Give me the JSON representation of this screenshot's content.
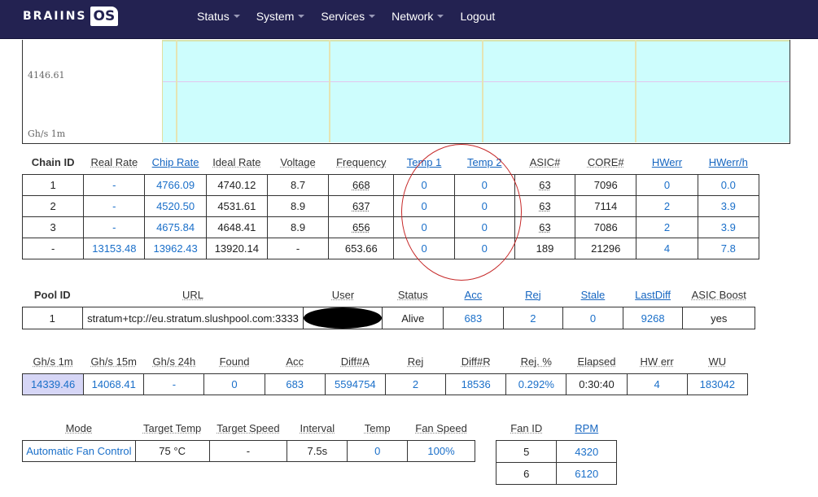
{
  "brand": {
    "name": "BRAIINS",
    "badge": "OS"
  },
  "nav": [
    "Status",
    "System",
    "Services",
    "Network",
    "Logout"
  ],
  "graph": {
    "ymax_label": "4146.61",
    "unit_label": "Gh/s 1m"
  },
  "chains": {
    "headers": [
      "Chain ID",
      "Real Rate",
      "Chip Rate",
      "Ideal Rate",
      "Voltage",
      "Frequency",
      "Temp 1",
      "Temp 2",
      "ASIC#",
      "CORE#",
      "HWerr",
      "HWerr/h"
    ],
    "rows": [
      [
        "1",
        "-",
        "4766.09",
        "4740.12",
        "8.7",
        "668",
        "0",
        "0",
        "63",
        "7096",
        "0",
        "0.0"
      ],
      [
        "2",
        "-",
        "4520.50",
        "4531.61",
        "8.9",
        "637",
        "0",
        "0",
        "63",
        "7114",
        "2",
        "3.9"
      ],
      [
        "3",
        "-",
        "4675.84",
        "4648.41",
        "8.9",
        "656",
        "0",
        "0",
        "63",
        "7086",
        "2",
        "3.9"
      ],
      [
        "-",
        "13153.48",
        "13962.43",
        "13920.14",
        "-",
        "653.66",
        "0",
        "0",
        "189",
        "21296",
        "4",
        "7.8"
      ]
    ]
  },
  "pools": {
    "headers": [
      "Pool ID",
      "URL",
      "User",
      "Status",
      "Acc",
      "Rej",
      "Stale",
      "LastDiff",
      "ASIC Boost"
    ],
    "row": [
      "1",
      "stratum+tcp://eu.stratum.slushpool.com:3333",
      "",
      "Alive",
      "683",
      "2",
      "0",
      "9268",
      "yes"
    ]
  },
  "summary": {
    "headers": [
      "Gh/s 1m",
      "Gh/s 15m",
      "Gh/s 24h",
      "Found",
      "Acc",
      "Diff#A",
      "Rej",
      "Diff#R",
      "Rej. %",
      "Elapsed",
      "HW err",
      "WU"
    ],
    "row": [
      "14339.46",
      "14068.41",
      "-",
      "0",
      "683",
      "5594754",
      "2",
      "18536",
      "0.292%",
      "0:30:40",
      "4",
      "183042"
    ]
  },
  "fan": {
    "headers": [
      "Mode",
      "Target Temp",
      "Target Speed",
      "Interval",
      "Temp",
      "Fan Speed"
    ],
    "row": [
      "Automatic Fan Control",
      "75 °C",
      "-",
      "7.5s",
      "0",
      "100%"
    ]
  },
  "fans": {
    "headers": [
      "Fan ID",
      "RPM"
    ],
    "rows": [
      [
        "5",
        "4320"
      ],
      [
        "6",
        "6120"
      ]
    ]
  },
  "colors": {
    "navbar": "#232251",
    "plot_bg": "#cdfdfd",
    "link": "#1a6fc9",
    "annotation": "#c62828"
  }
}
